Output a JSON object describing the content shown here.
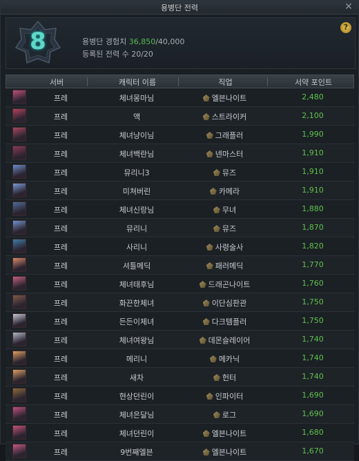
{
  "window": {
    "title": "용병단 전력"
  },
  "header": {
    "level": "8",
    "exp_label": "용병단 경험치",
    "exp_current": "36,850",
    "exp_max": "/40,000",
    "members_label": "등록된 전력 수",
    "members_value": "20/20"
  },
  "columns": {
    "server": "서버",
    "name": "캐릭터 이름",
    "job": "직업",
    "points": "서약 포인트"
  },
  "rows": [
    {
      "server": "프레",
      "name": "체녀몽마님",
      "job": "엘븐나이트",
      "points": "2,480",
      "color": "#c0507a"
    },
    {
      "server": "프레",
      "name": "액",
      "job": "스트라이커",
      "points": "2,100",
      "color": "#b6405f"
    },
    {
      "server": "프레",
      "name": "체녀냥이님",
      "job": "그래플러",
      "points": "1,990",
      "color": "#a84860"
    },
    {
      "server": "프레",
      "name": "체녀백란님",
      "job": "넨마스터",
      "points": "1,910",
      "color": "#8c3a58"
    },
    {
      "server": "프레",
      "name": "뮤리니3",
      "job": "뮤즈",
      "points": "1,910",
      "color": "#6a8fcc"
    },
    {
      "server": "프레",
      "name": "미쳐버린",
      "job": "카메라",
      "points": "1,910",
      "color": "#7a9ad6"
    },
    {
      "server": "프레",
      "name": "체녀신랑님",
      "job": "무녀",
      "points": "1,880",
      "color": "#4f6d9a"
    },
    {
      "server": "프레",
      "name": "뮤리니",
      "job": "뮤즈",
      "points": "1,870",
      "color": "#6f94cf"
    },
    {
      "server": "프레",
      "name": "사리니",
      "job": "사령술사",
      "points": "1,820",
      "color": "#3f7aa8"
    },
    {
      "server": "프레",
      "name": "셔틀메딕",
      "job": "패러메딕",
      "points": "1,770",
      "color": "#d98a6a"
    },
    {
      "server": "프레",
      "name": "체녀태후님",
      "job": "드래곤나이트",
      "points": "1,760",
      "color": "#c45f7e"
    },
    {
      "server": "프레",
      "name": "화끈한체녀",
      "job": "이단심판관",
      "points": "1,750",
      "color": "#7f5a4a"
    },
    {
      "server": "프레",
      "name": "든든이체녀",
      "job": "다크템플러",
      "points": "1,750",
      "color": "#c8c8d8"
    },
    {
      "server": "프레",
      "name": "체녀여왕님",
      "job": "데몬슬레이어",
      "points": "1,740",
      "color": "#b0b8c8"
    },
    {
      "server": "프레",
      "name": "메리니",
      "job": "메카닉",
      "points": "1,740",
      "color": "#e0a060"
    },
    {
      "server": "프레",
      "name": "새차",
      "job": "헌터",
      "points": "1,740",
      "color": "#d9a064"
    },
    {
      "server": "프레",
      "name": "현상던린이",
      "job": "인파이터",
      "points": "1,690",
      "color": "#8a6a3a"
    },
    {
      "server": "프레",
      "name": "체녀은달님",
      "job": "로그",
      "points": "1,690",
      "color": "#c05080"
    },
    {
      "server": "프레",
      "name": "체녀던린이",
      "job": "엘븐나이트",
      "points": "1,680",
      "color": "#c4547a"
    },
    {
      "server": "프레",
      "name": "9번째엘븐",
      "job": "엘븐나이트",
      "points": "1,670",
      "color": "#c85a82"
    }
  ]
}
